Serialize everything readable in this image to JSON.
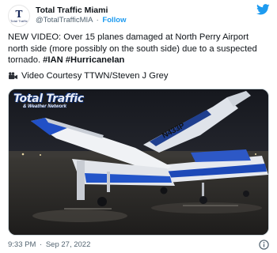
{
  "account": {
    "avatar_letter": "T",
    "avatar_sub": "Total Traffic",
    "display_name": "Total Traffic Miami",
    "handle": "@TotalTrafficMIA",
    "separator": "·",
    "follow_label": "Follow"
  },
  "tweet": {
    "text_plain": "NEW VIDEO: Over 15 planes damaged at North Perry Airport north side (more possibly on the south side) due to a suspected tornado. ",
    "hashtag_1": "#IAN",
    "hashtag_2": "#HurricaneIan",
    "credit": "Video Courtesy TTWN/Steven J Grey"
  },
  "media": {
    "watermark_title": "Total Traffic",
    "watermark_sub": "& Weather Network",
    "tail_number": "N433P"
  },
  "footer": {
    "time": "9:33 PM",
    "separator": "·",
    "date": "Sep 27, 2022"
  },
  "icons": {
    "brand": "twitter-bird-icon",
    "camera": "movie-camera-icon",
    "info": "info-icon"
  },
  "colors": {
    "accent": "#1d9bf0",
    "text": "#0f1419",
    "muted": "#536471"
  }
}
